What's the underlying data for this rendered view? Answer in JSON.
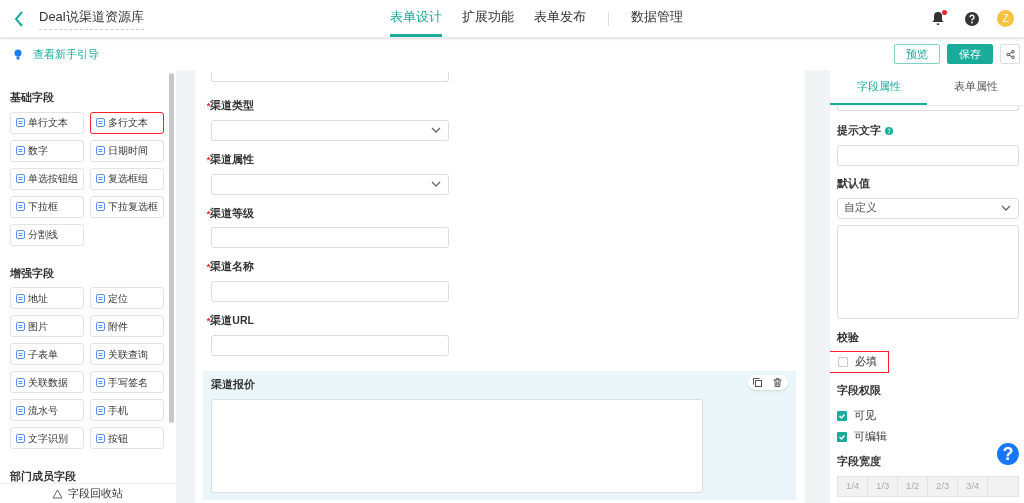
{
  "header": {
    "title": "Deal说渠道资源库",
    "tabs": [
      {
        "label": "表单设计",
        "selected": true
      },
      {
        "label": "扩展功能",
        "selected": false
      },
      {
        "label": "表单发布",
        "selected": false
      },
      {
        "label": "数据管理",
        "selected": false
      }
    ],
    "notification_dot": true,
    "avatar": "Z"
  },
  "toolbar": {
    "guide_link": "查看新手引导",
    "buttons": [
      {
        "label": "预览",
        "kind": "outline"
      },
      {
        "label": "保存",
        "kind": "primary"
      }
    ]
  },
  "palette": {
    "groups": [
      {
        "title": "基础字段",
        "items": [
          {
            "label": "单行文本",
            "highlighted": false
          },
          {
            "label": "多行文本",
            "highlighted": true
          },
          {
            "label": "数字",
            "highlighted": false
          },
          {
            "label": "日期时间",
            "highlighted": false
          },
          {
            "label": "单选按钮组",
            "highlighted": false
          },
          {
            "label": "复选框组",
            "highlighted": false
          },
          {
            "label": "下拉框",
            "highlighted": false
          },
          {
            "label": "下拉复选框",
            "highlighted": false
          },
          {
            "label": "分割线",
            "highlighted": false
          }
        ]
      },
      {
        "title": "增强字段",
        "items": [
          {
            "label": "地址",
            "highlighted": false
          },
          {
            "label": "定位",
            "highlighted": false
          },
          {
            "label": "图片",
            "highlighted": false
          },
          {
            "label": "附件",
            "highlighted": false
          },
          {
            "label": "子表单",
            "highlighted": false
          },
          {
            "label": "关联查询",
            "highlighted": false
          },
          {
            "label": "关联数据",
            "highlighted": false
          },
          {
            "label": "手写签名",
            "highlighted": false
          },
          {
            "label": "流水号",
            "highlighted": false
          },
          {
            "label": "手机",
            "highlighted": false
          },
          {
            "label": "文字识别",
            "highlighted": false
          },
          {
            "label": "按钮",
            "highlighted": false
          }
        ]
      },
      {
        "title": "部门成员字段"
      }
    ],
    "recycle_bin": "字段回收站"
  },
  "form": {
    "required_mark": "*",
    "fields": [
      {
        "label": "渠道类型",
        "required": true,
        "kind": "select",
        "selected": false
      },
      {
        "label": "渠道属性",
        "required": true,
        "kind": "select",
        "selected": false
      },
      {
        "label": "渠道等级",
        "required": true,
        "kind": "input",
        "selected": false
      },
      {
        "label": "渠道名称",
        "required": true,
        "kind": "input",
        "selected": false
      },
      {
        "label": "渠道URL",
        "required": true,
        "kind": "input",
        "selected": false
      },
      {
        "label": "渠道报价",
        "required": false,
        "kind": "textarea",
        "selected": true
      }
    ]
  },
  "properties": {
    "tabs": [
      {
        "label": "字段属性",
        "selected": true
      },
      {
        "label": "表单属性",
        "selected": false
      }
    ],
    "hint_label": "提示文字",
    "default_label": "默认值",
    "default_select": "自定义",
    "validation_label": "校验",
    "validation": [
      {
        "label": "必填",
        "checked": false,
        "highlighted": true
      }
    ],
    "permission_label": "字段权限",
    "permissions": [
      {
        "label": "可见",
        "checked": true,
        "highlighted": false
      },
      {
        "label": "可编辑",
        "checked": true,
        "highlighted": false
      }
    ],
    "width_label": "字段宽度",
    "widths": [
      "1/4",
      "1/3",
      "1/2",
      "2/3",
      "3/4"
    ]
  },
  "help_button": "?"
}
